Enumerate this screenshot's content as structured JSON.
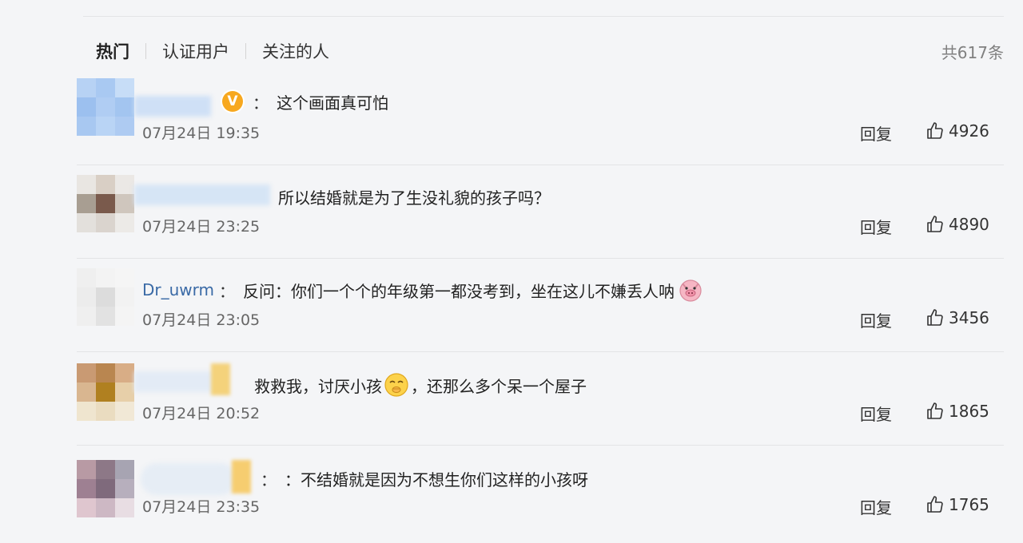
{
  "tabs": {
    "hot": "热门",
    "verified": "认证用户",
    "following": "关注的人"
  },
  "total": "共617条",
  "reply_label": "回复",
  "comments": [
    {
      "username": "",
      "colon": "：",
      "text": "这个画面真可怕",
      "time": "07月24日 19:35",
      "likes": "4926"
    },
    {
      "username": "",
      "colon": "",
      "text": "所以结婚就是为了生没礼貌的孩子吗？",
      "time": "07月24日 23:25",
      "likes": "4890"
    },
    {
      "username": "Dr_uwrm",
      "colon": "：",
      "text": "反问：你们一个个的年级第一都没考到，坐在这儿不嫌丢人呐",
      "time": "07月24日 23:05",
      "likes": "3456"
    },
    {
      "username": "",
      "colon": "",
      "text_before": "救救我，讨厌小孩",
      "text_after": "，还那么多个呆一个屋子",
      "time": "07月24日 20:52",
      "likes": "1865"
    },
    {
      "username": "",
      "colon": "：",
      "text": "：不结婚就是因为不想生你们这样的小孩呀",
      "time": "07月24日 23:35",
      "likes": "1765"
    }
  ],
  "icons": {
    "verified": "v-badge-icon",
    "like": "thumbs-up-icon",
    "pig": "pig-emoji-icon",
    "face": "shushing-face-emoji-icon"
  },
  "colors": {
    "username": "#3a6aa6",
    "verified_badge": "#f7a81f",
    "background": "#f4f5f7"
  }
}
